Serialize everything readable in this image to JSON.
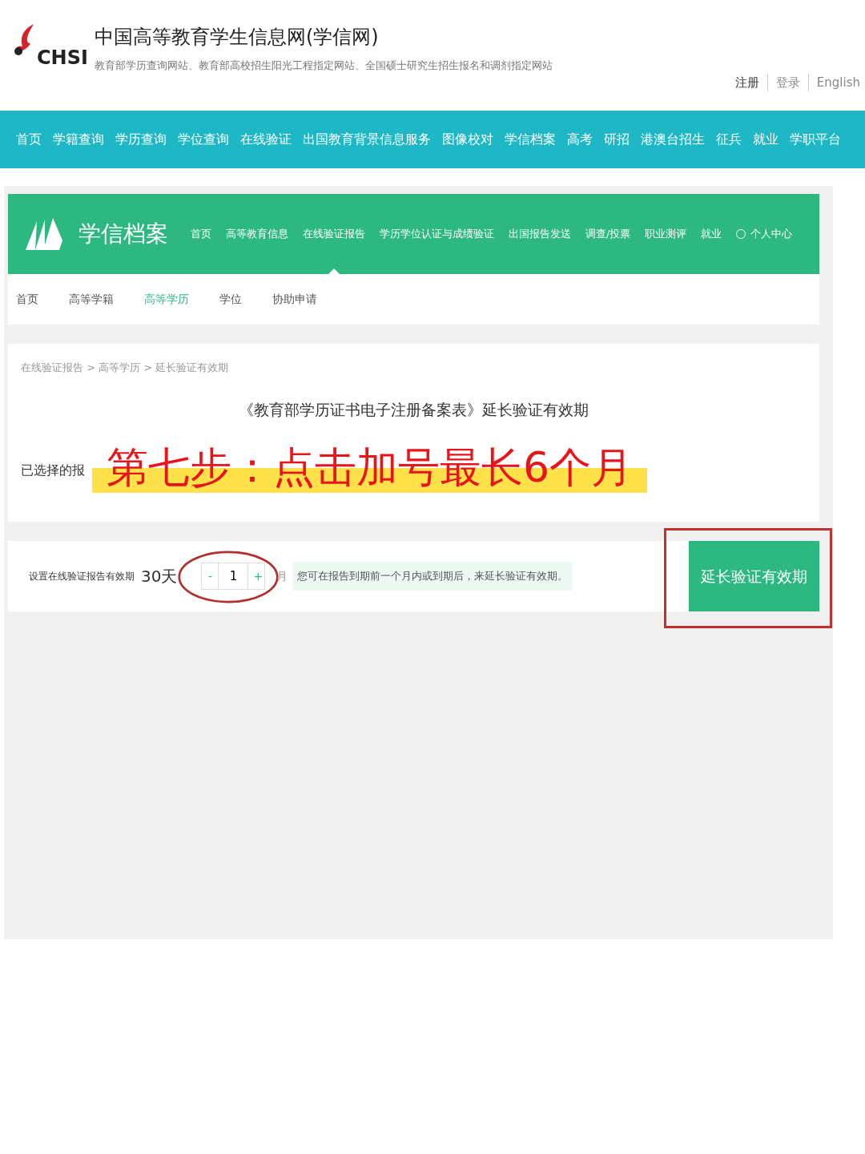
{
  "site_header": {
    "logo_text": "CHSI",
    "title": "中国高等教育学生信息网(学信网)",
    "subtitle": "教育部学历查询网站、教育部高校招生阳光工程指定网站、全国硕士研究生招生报名和调剂指定网站",
    "links": [
      "注册",
      "登录",
      "English"
    ]
  },
  "main_nav": [
    "首页",
    "学籍查询",
    "学历查询",
    "学位查询",
    "在线验证",
    "出国教育背景信息服务",
    "图像校对",
    "学信档案",
    "高考",
    "研招",
    "港澳台招生",
    "征兵",
    "就业",
    "学职平台"
  ],
  "archive_header": {
    "brand": "学信档案",
    "nav": [
      {
        "label": "首页",
        "selected": false
      },
      {
        "label": "高等教育信息",
        "selected": false
      },
      {
        "label": "在线验证报告",
        "selected": true
      },
      {
        "label": "学历学位认证与成绩验证",
        "selected": false
      },
      {
        "label": "出国报告发送",
        "selected": false
      },
      {
        "label": "调查/投票",
        "selected": false
      },
      {
        "label": "职业测评",
        "selected": false
      },
      {
        "label": "就业",
        "selected": false
      }
    ],
    "user_link": "个人中心"
  },
  "sub_nav": [
    {
      "label": "首页",
      "selected": false
    },
    {
      "label": "高等学籍",
      "selected": false
    },
    {
      "label": "高等学历",
      "selected": true
    },
    {
      "label": "学位",
      "selected": false
    },
    {
      "label": "协助申请",
      "selected": false
    }
  ],
  "breadcrumb": "在线验证报告 > 高等学历 > 延长验证有效期",
  "page_title": "《教育部学历证书电子注册备案表》延长验证有效期",
  "selected_label": "已选择的报",
  "validity": {
    "label": "设置在线验证报告有效期",
    "days": "30天",
    "minus": "-",
    "value": "1",
    "plus": "+",
    "unit": "月",
    "hint": "您可在报告到期前一个月内或到期后，来延长验证有效期。",
    "button": "延长验证有效期"
  },
  "annotation": {
    "text": "第七步：点击加号最长6个月"
  }
}
